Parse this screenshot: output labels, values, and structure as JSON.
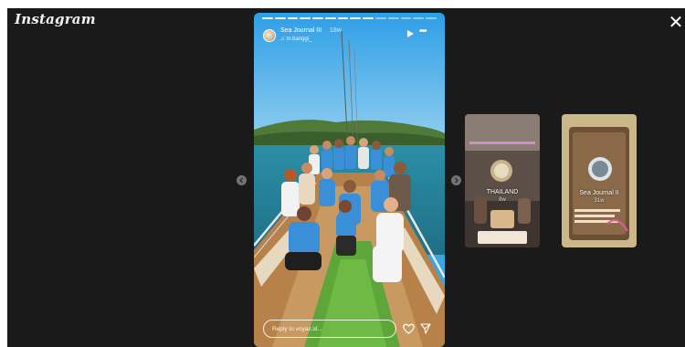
{
  "app": {
    "logo": "Instagram"
  },
  "story": {
    "account_name": "Sea Journal III",
    "time_ago": "18w",
    "music_label": "m.banggi_",
    "progress_total": 14,
    "progress_done": 9,
    "reply_placeholder": "Reply to voyaz.id..."
  },
  "previews": [
    {
      "title": "THAILAND",
      "subtitle": "8w"
    },
    {
      "title": "Sea Journal II",
      "subtitle": "31w"
    }
  ],
  "icons": {
    "close": "close-icon",
    "play": "play-icon",
    "more": "more-icon",
    "heart": "heart-icon",
    "send": "send-icon",
    "prev": "chevron-left-icon",
    "next": "chevron-right-icon",
    "music": "music-note-icon"
  },
  "colors": {
    "viewer_bg": "#1a1a1a",
    "sky": "#3aa7e0",
    "shirt_blue": "#3b8ed8"
  }
}
